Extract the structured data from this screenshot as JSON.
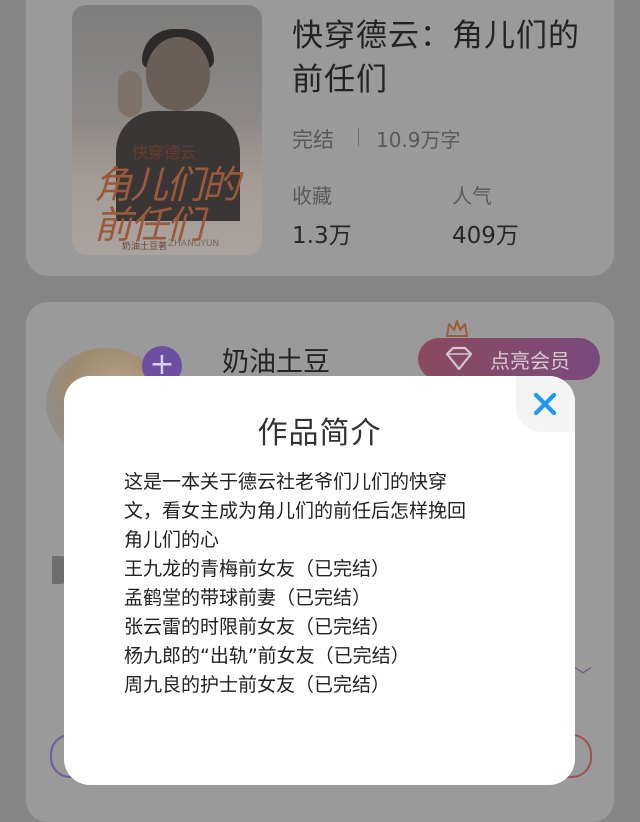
{
  "book": {
    "title": "快穿德云：角儿们的前任们",
    "status": "完结",
    "word_count": "10.9万字",
    "stats": [
      {
        "label": "收藏",
        "value": "1.3万"
      },
      {
        "label": "人气",
        "value": "409万"
      }
    ],
    "cover_text": {
      "series": "快穿德云",
      "title": "角儿们的前任们",
      "author": "奶油土豆著",
      "tag": "ZHANGYUN"
    }
  },
  "author": {
    "name": "奶油土豆",
    "follow_symbol": "+",
    "vip_label": "点亮会员"
  },
  "dialog": {
    "title": "作品简介",
    "lines": [
      "这是一本关于德云社老爷们儿们的快穿",
      "文，看女主成为角儿们的前任后怎样挽回",
      "角儿们的心",
      "王九龙的青梅前女友（已完结）",
      "孟鹤堂的带球前妻（已完结）",
      "张云雷的时限前女友（已完结）",
      "杨九郎的“出轨”前女友（已完结）",
      "周九良的护士前女友（已完结）"
    ]
  },
  "colors": {
    "overlay_background": "#868686",
    "dialog_background": "#ffffff",
    "close_icon": "#2196f3",
    "vip_gradient_start": "#8a4a5e",
    "accent_purple": "#6c4fa0"
  },
  "icons": {
    "close": "close-icon",
    "diamond": "diamond-icon",
    "crown": "crown-icon",
    "plus": "plus-icon"
  }
}
